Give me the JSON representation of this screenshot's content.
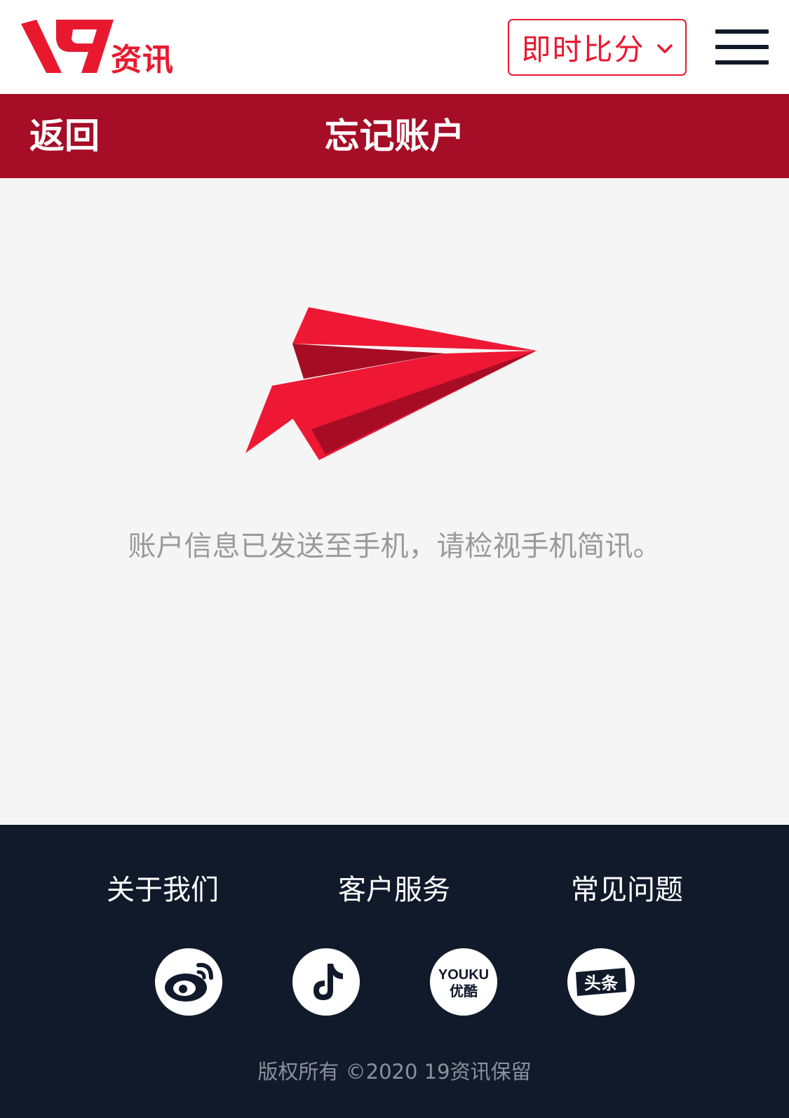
{
  "header": {
    "logo_text": "资讯",
    "score_label": "即时比分",
    "icons": {
      "logo": "19-logo",
      "score_dropdown": "chevron-down-icon",
      "menu": "hamburger-menu-icon"
    }
  },
  "titlebar": {
    "back_label": "返回",
    "title": "忘记账户"
  },
  "main": {
    "icon": "paper-plane-icon",
    "message": "账户信息已发送至手机，请检视手机简讯。"
  },
  "footer": {
    "links": [
      {
        "label": "关于我们"
      },
      {
        "label": "客户服务"
      },
      {
        "label": "常见问题"
      }
    ],
    "social": [
      {
        "icon": "weibo-icon"
      },
      {
        "icon": "douyin-icon"
      },
      {
        "icon": "youku-icon",
        "text": "YOUKU",
        "sub": "优酷"
      },
      {
        "icon": "toutiao-icon",
        "text": "头条"
      }
    ],
    "copyright": "版权所有 ©2020 19资讯保留"
  },
  "colors": {
    "brand_red": "#e8192f",
    "title_bar": "#a60d27",
    "footer_bg": "#111a2b",
    "page_bg": "#f5f5f5",
    "message_text": "#9a9a9a"
  }
}
